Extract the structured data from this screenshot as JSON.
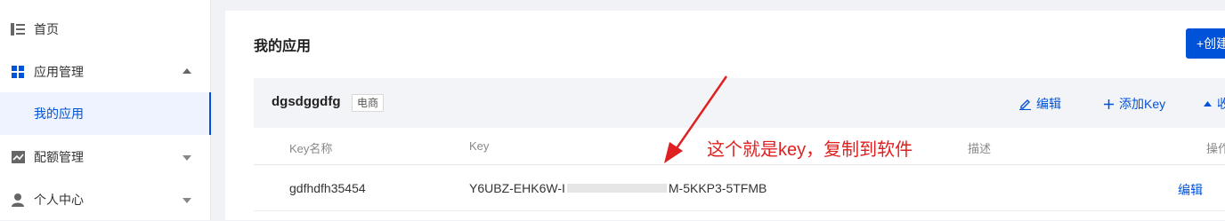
{
  "sidebar": {
    "items": [
      {
        "label": "首页",
        "icon": "list-icon"
      },
      {
        "label": "应用管理",
        "icon": "grid-icon",
        "expanded": true
      },
      {
        "label": "我的应用",
        "active": true
      },
      {
        "label": "配额管理",
        "icon": "chart-icon"
      },
      {
        "label": "个人中心",
        "icon": "user-icon"
      }
    ]
  },
  "main": {
    "title": "我的应用",
    "create_label": "+创建"
  },
  "app": {
    "name": "dgsdggdfg",
    "tag": "电商",
    "actions": {
      "edit": "编辑",
      "add_key": "添加Key",
      "collapse": "收"
    }
  },
  "table": {
    "headers": {
      "key_name": "Key名称",
      "key": "Key",
      "desc": "描述",
      "ops": "操作"
    },
    "rows": [
      {
        "key_name": "gdfhdfh35454",
        "key_prefix": "Y6UBZ-EHK6W-I",
        "key_suffix": "M-5KKP3-5TFMB",
        "edit": "编辑"
      }
    ]
  },
  "annotation": {
    "text": "这个就是key，复制到软件",
    "color": "#e02020"
  },
  "colors": {
    "accent": "#0052d9"
  }
}
